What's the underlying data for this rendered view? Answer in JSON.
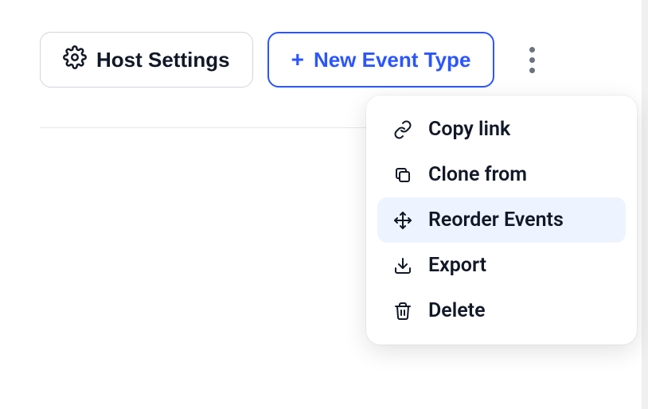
{
  "toolbar": {
    "host_settings_label": "Host Settings",
    "new_event_label": "New Event Type"
  },
  "menu": {
    "items": [
      {
        "label": "Copy link",
        "icon": "link-icon",
        "highlight": false
      },
      {
        "label": "Clone from",
        "icon": "clone-icon",
        "highlight": false
      },
      {
        "label": "Reorder Events",
        "icon": "move-icon",
        "highlight": true
      },
      {
        "label": "Export",
        "icon": "download-icon",
        "highlight": false
      },
      {
        "label": "Delete",
        "icon": "trash-icon",
        "highlight": false
      }
    ]
  }
}
